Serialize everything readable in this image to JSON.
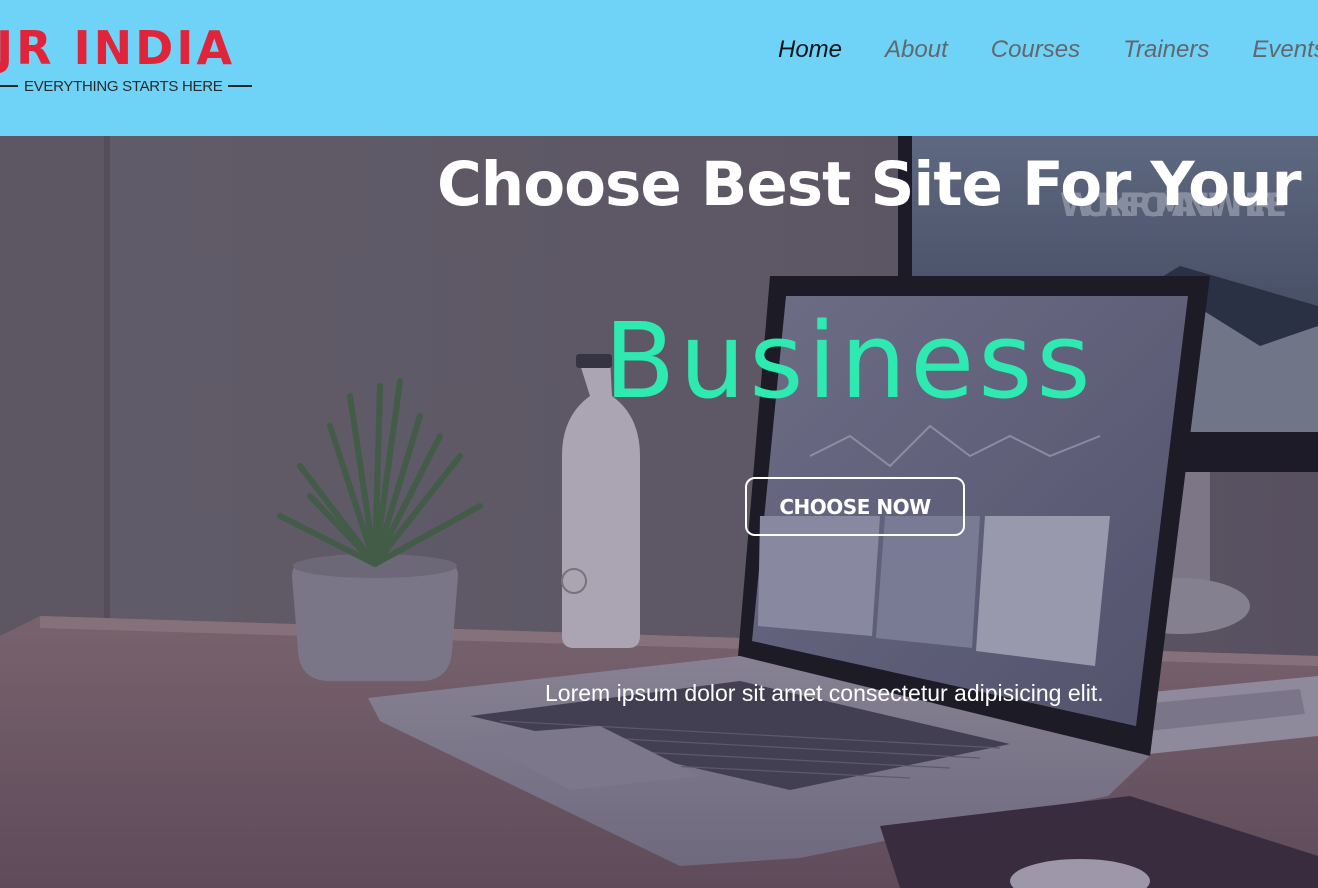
{
  "header": {
    "logo": {
      "name": "JR INDIA",
      "tagline": "EVERYTHING STARTS HERE"
    },
    "nav": [
      {
        "label": "Home",
        "active": true
      },
      {
        "label": "About",
        "active": false
      },
      {
        "label": "Courses",
        "active": false
      },
      {
        "label": "Trainers",
        "active": false
      },
      {
        "label": "Events",
        "active": false
      }
    ]
  },
  "hero": {
    "title": "Choose Best Site For Your",
    "highlight": "Business",
    "cta_label": "CHOOSE NOW",
    "subtitle": "Lorem ipsum dolor sit amet consectetur adipisicing elit.",
    "monitor_text": "WORK FROM ANYWHERE"
  },
  "colors": {
    "header_bg": "#6fd3f8",
    "brand_red": "#e0253a",
    "accent_green": "#2eeab0",
    "nav_text": "#62676b",
    "nav_active": "#101418"
  }
}
